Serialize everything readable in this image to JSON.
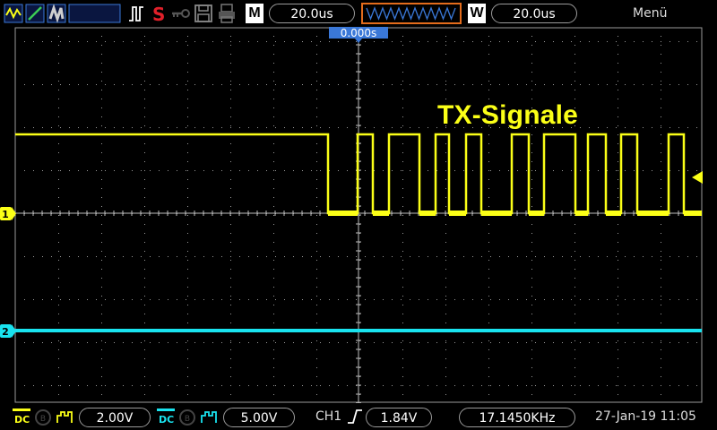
{
  "topbar": {
    "mode_icons": [
      "wave-zigzag-icon",
      "slope-icon",
      "persistence-icon",
      "blank-panel"
    ],
    "tool_icons": [
      "pulse-icon",
      "s-icon",
      "key-icon",
      "save-icon",
      "print-icon"
    ],
    "m_label": "M",
    "m_value": "20.0us",
    "w_label": "W",
    "w_value": "20.0us",
    "menu_label": "Menü"
  },
  "screen": {
    "trigger_time": "0.000s",
    "ch1_marker": "1",
    "ch2_marker": "2",
    "annotation": "TX-Signale",
    "colors": {
      "ch1": "#fbff17",
      "ch2": "#19e3ef",
      "grid": "#9a9a9a",
      "trigger_marker": "#3a78d8"
    }
  },
  "bottombar": {
    "ch1_coupling": "DC",
    "ch1_volts": "2.00V",
    "ch2_coupling": "DC",
    "ch2_volts": "5.00V",
    "trigger_source": "CH1",
    "trigger_level": "1.84V",
    "frequency": "17.1450KHz",
    "datetime": "27-Jan-19 11:05"
  }
}
